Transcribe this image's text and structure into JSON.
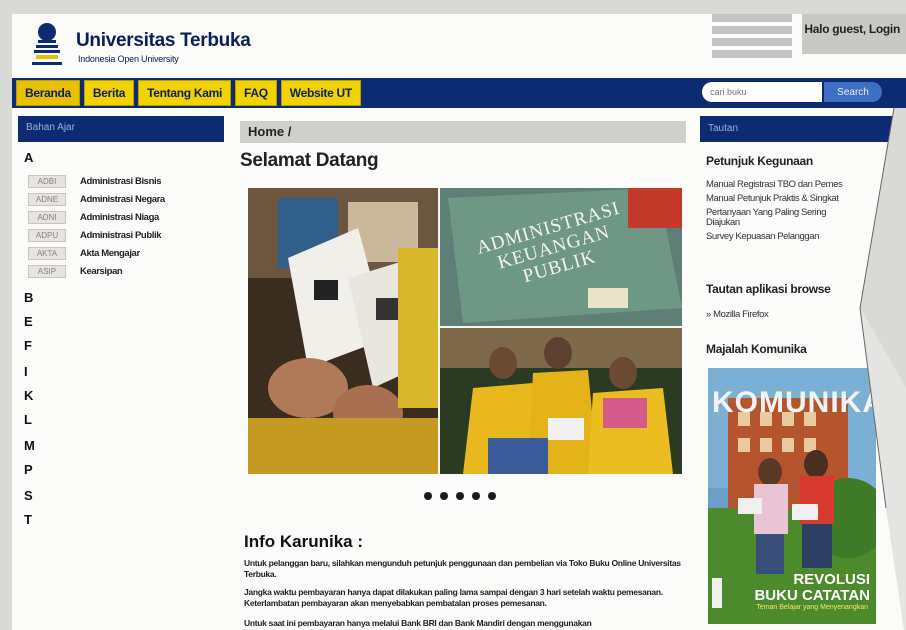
{
  "header": {
    "brand_name": "Universitas Terbuka",
    "brand_sub": "Indonesia Open University",
    "greeting": "Halo guest, Login"
  },
  "nav": {
    "items": [
      "Beranda",
      "Berita",
      "Tentang Kami",
      "FAQ",
      "Website UT"
    ],
    "search_placeholder": "cari buku",
    "search_button": "Search"
  },
  "sidebar": {
    "header": "Bahan Ajar",
    "groups": [
      {
        "letter": "A",
        "courses": [
          {
            "code": "ADBI",
            "name": "Administrasi Bisnis"
          },
          {
            "code": "ADNE",
            "name": "Administrasi Negara"
          },
          {
            "code": "ADNI",
            "name": "Administrasi Niaga"
          },
          {
            "code": "ADPU",
            "name": "Administrasi Publik"
          },
          {
            "code": "AKTA",
            "name": "Akta Mengajar"
          },
          {
            "code": "ASIP",
            "name": "Kearsipan"
          }
        ]
      },
      {
        "letter": "B"
      },
      {
        "letter": "E"
      },
      {
        "letter": "F"
      },
      {
        "letter": "I"
      },
      {
        "letter": "K"
      },
      {
        "letter": "L"
      },
      {
        "letter": "M"
      },
      {
        "letter": "P"
      },
      {
        "letter": "S"
      },
      {
        "letter": "T"
      }
    ]
  },
  "main": {
    "breadcrumb": "Home /",
    "title": "Selamat Datang",
    "slide_book_text": [
      "ADMINISTRASI",
      "KEUANGAN",
      "PUBLIK"
    ],
    "info_title": "Info Karunika :",
    "info_paragraphs": [
      "Untuk pelanggan baru, silahkan mengunduh petunjuk penggunaan dan pembelian via Toko Buku Online Universitas Terbuka.",
      "Jangka waktu pembayaran hanya dapat dilakukan paling lama sampai dengan 3 hari setelah waktu pemesanan. Keterlambatan pembayaran akan menyebabkan pembatalan proses pemesanan.",
      "Untuk saat ini pembayaran hanya melalui Bank BRI dan Bank Mandiri dengan menggunakan"
    ]
  },
  "right": {
    "header": "Tautan",
    "petunjuk_title": "Petunjuk Kegunaan",
    "petunjuk_links": [
      "Manual Registrasi TBO dan Pemes",
      "Manual Petunjuk Praktis & Singkat",
      "Pertanyaan Yang Paling Sering",
      "Diajukan",
      "Survey Kepuasan Pelanggan"
    ],
    "browser_title": "Tautan aplikasi browse",
    "browser_link": "Mozilla Firefox",
    "majalah_title": "Majalah Komunika",
    "magazine": {
      "masthead": "KOMUNIKA",
      "headline_1": "REVOLUSI",
      "headline_2": "BUKU CATATAN",
      "sub": "Teman Belajar yang Menyenangkan"
    }
  },
  "colors": {
    "nav_blue": "#0d2b73",
    "nav_yellow": "#f2d200"
  }
}
